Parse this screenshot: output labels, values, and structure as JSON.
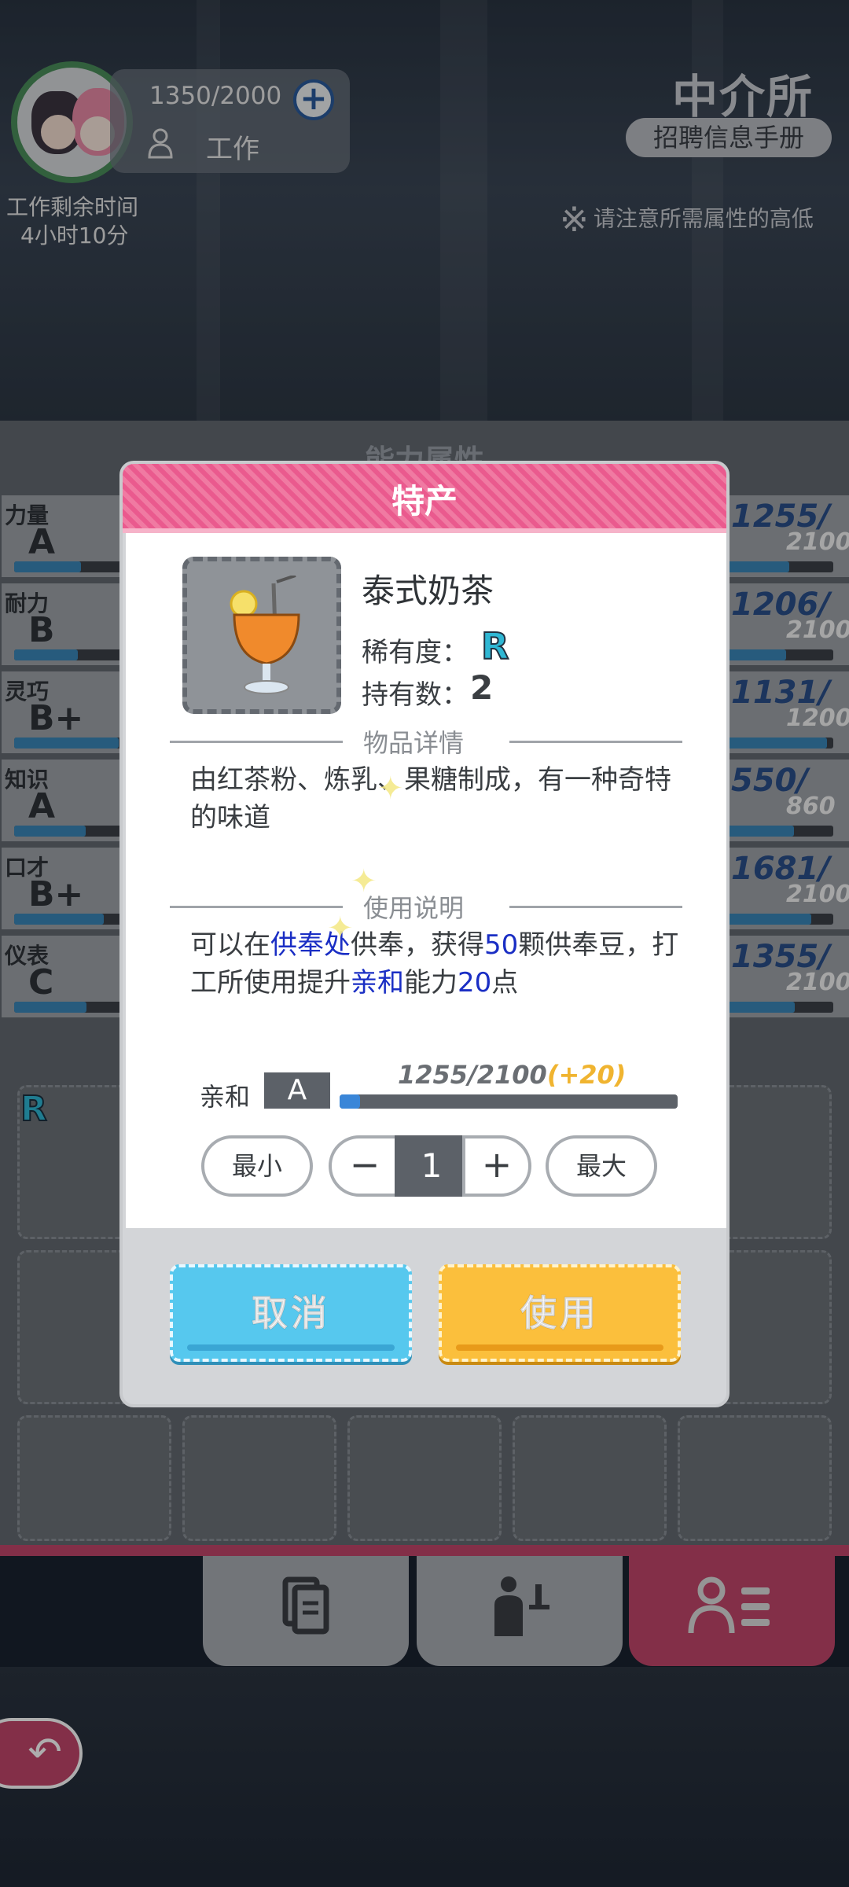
{
  "status": {
    "energy": "1350/2000",
    "job_label": "工作",
    "time_left_label": "工作剩余时间",
    "time_left_value": "4小时10分"
  },
  "agency": {
    "title": "中介所",
    "handbook_button": "招聘信息手册",
    "note": "请注意所需属性的高低"
  },
  "abilities": {
    "header": "能力属性",
    "rows": [
      {
        "name": "力量",
        "grade": "A",
        "current": "1255",
        "max": "2100",
        "fill": 0.6
      },
      {
        "name": "耐力",
        "grade": "B",
        "current": "1206",
        "max": "2100",
        "fill": 0.57
      },
      {
        "name": "灵巧",
        "grade": "B+",
        "current": "1131",
        "max": "1200",
        "fill": 0.94
      },
      {
        "name": "知识",
        "grade": "A",
        "current": "550",
        "max": "860",
        "fill": 0.64
      },
      {
        "name": "口才",
        "grade": "B+",
        "current": "1681",
        "max": "2100",
        "fill": 0.8
      },
      {
        "name": "仪表",
        "grade": "C",
        "current": "1355",
        "max": "2100",
        "fill": 0.65
      }
    ]
  },
  "inventory": {
    "badge": "R"
  },
  "modal": {
    "title": "特产",
    "item_name": "泰式奶茶",
    "rarity_label": "稀有度：",
    "rarity_value": "R",
    "owned_label": "持有数：",
    "owned_value": "2",
    "details_title": "物品详情",
    "description": "由红茶粉、炼乳、果糖制成，有一种奇特的味道",
    "usage_title": "使用说明",
    "usage": {
      "p1": "可以在",
      "h1": "供奉处",
      "p2": "供奉，获得",
      "h2": "50",
      "p3": "颗供奉豆，打工所使用提升",
      "h3": "亲和",
      "p4": "能力",
      "h4": "20",
      "p5": "点"
    },
    "affinity": {
      "label": "亲和",
      "grade": "A",
      "progress_text": "1255/2100",
      "bonus_text": "(+20)",
      "fill": 0.06
    },
    "quantity": {
      "min_label": "最小",
      "max_label": "最大",
      "minus": "−",
      "plus": "+",
      "value": "1"
    },
    "cancel_button": "取消",
    "use_button": "使用"
  },
  "colors": {
    "accent_pink": "#ea5a8e",
    "cancel_blue": "#56c8ee",
    "use_yellow": "#fbbf3c",
    "highlight_blue": "#1a2ec4",
    "bonus_yellow": "#f0b430"
  },
  "icons": {
    "plus": "plus-circle-icon",
    "work": "worker-icon",
    "note": "asterisk-icon",
    "tabs": [
      "document-icon",
      "waiter-icon",
      "profile-list-icon"
    ],
    "back": "back-arrow-icon"
  }
}
